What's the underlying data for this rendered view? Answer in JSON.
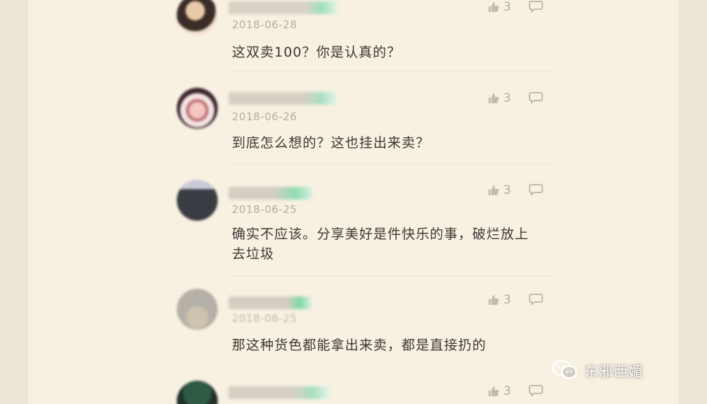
{
  "comments": [
    {
      "date": "2018-06-28",
      "text": "这双卖100？你是认真的？",
      "likes": "3"
    },
    {
      "date": "2018-06-26",
      "text": "到底怎么想的？这也挂出来卖？",
      "likes": "3"
    },
    {
      "date": "2018-06-25",
      "text": "确实不应该。分享美好是件快乐的事，破烂放上去垃圾",
      "likes": "3"
    },
    {
      "date": "2018-06-25",
      "text": "那这种货色都能拿出来卖，都是直接扔的",
      "likes": "3"
    },
    {
      "date": "",
      "text": "",
      "likes": "3"
    }
  ],
  "watermark": {
    "text": "东邪西媚",
    "icon": "wechat-icon"
  },
  "icons": {
    "like": "thumbs-up-icon",
    "reply": "comment-bubble-icon"
  },
  "colors": {
    "background": "#f8f1e2",
    "text": "#3b3934",
    "muted": "#b3ada2",
    "name_blur_accent": "#7fd8a8"
  }
}
